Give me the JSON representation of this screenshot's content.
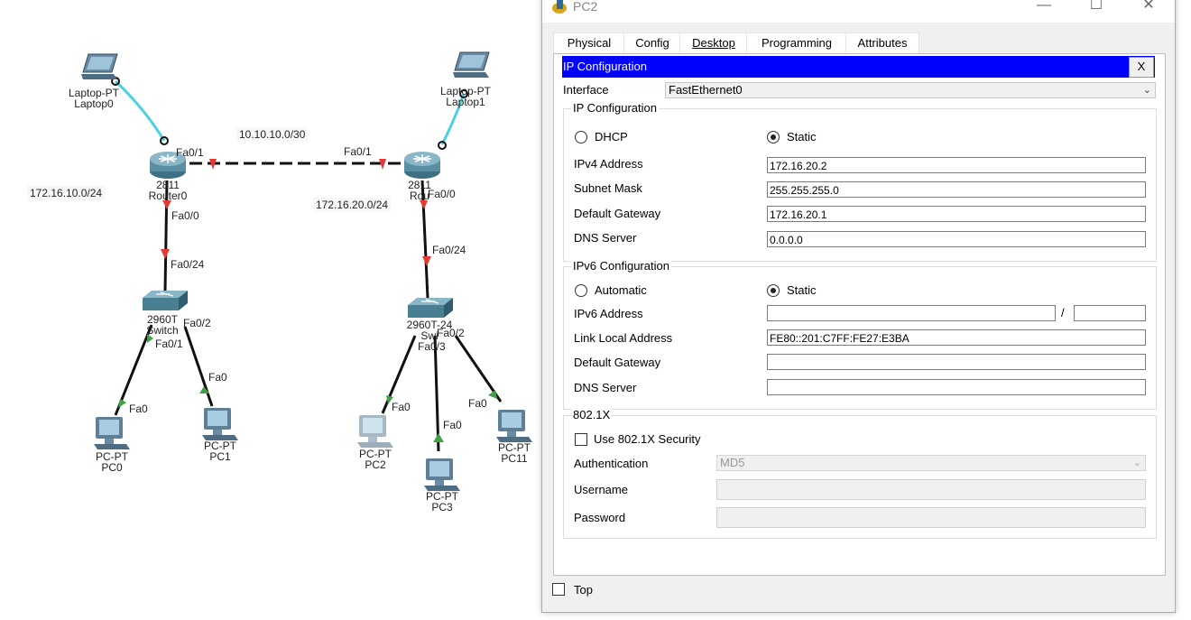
{
  "topology": {
    "devices": {
      "laptop0": {
        "line1": "Laptop-PT",
        "line2": "Laptop0"
      },
      "laptop1": {
        "line1": "Laptop-PT",
        "line2": "Laptop1"
      },
      "router0": {
        "line1": "2811",
        "line2": "Router0"
      },
      "router1": {
        "line1": "2811",
        "line2": "Rou"
      },
      "switch0": {
        "line1": "2960T",
        "line2": "Switch"
      },
      "switch1": {
        "line1": "2960T-24",
        "line2": "Swi"
      },
      "pc0": {
        "line1": "PC-PT",
        "line2": "PC0"
      },
      "pc1": {
        "line1": "PC-PT",
        "line2": "PC1"
      },
      "pc2": {
        "line1": "PC-PT",
        "line2": "PC2"
      },
      "pc3": {
        "line1": "PC-PT",
        "line2": "PC3"
      },
      "pc11": {
        "line1": "PC-PT",
        "line2": "PC11"
      }
    },
    "networks": {
      "wan": "10.10.10.0/30",
      "lan0": "172.16.10.0/24",
      "lan1": "172.16.20.0/24"
    },
    "ports": {
      "r0_fa01": "Fa0/1",
      "r0_fa00": "Fa0/0",
      "sw0_fa024": "Fa0/24",
      "sw0_fa02": "Fa0/2",
      "sw0_fa01": "Fa0/1",
      "pc0_fa0": "Fa0",
      "pc1_fa0": "Fa0",
      "r1_fa01": "Fa0/1",
      "r1_fa00": "Fa0/0",
      "sw1_fa024": "Fa0/24",
      "sw1_fa02": "Fa0/2",
      "sw1_fa03": "Fa0/3",
      "pc2_fa0": "Fa0",
      "pc3_fa0": "Fa0",
      "pc11_fa0": "Fa0"
    }
  },
  "window": {
    "title": "PC2",
    "buttons": {
      "minimize": "—",
      "maximize": "☐",
      "close": "✕"
    },
    "tabs": [
      {
        "label": "Physical"
      },
      {
        "label": "Config"
      },
      {
        "label": "Desktop"
      },
      {
        "label": "Programming"
      },
      {
        "label": "Attributes"
      }
    ],
    "active_tab": "Desktop",
    "ip_config": {
      "title": "IP Configuration",
      "close": "X",
      "interface_label": "Interface",
      "interface_value": "FastEthernet0",
      "ipv4_group": "IP Configuration",
      "dhcp_label": "DHCP",
      "static_label": "Static",
      "ipv4_address_label": "IPv4 Address",
      "ipv4_address": "172.16.20.2",
      "subnet_mask_label": "Subnet Mask",
      "subnet_mask": "255.255.255.0",
      "gateway_label": "Default Gateway",
      "gateway": "172.16.20.1",
      "dns_label": "DNS Server",
      "dns": "0.0.0.0",
      "ipv6_group": "IPv6 Configuration",
      "auto_label": "Automatic",
      "static6_label": "Static",
      "ipv6_address_label": "IPv6 Address",
      "ipv6_address": "",
      "ipv6_slash": "/",
      "ipv6_prefix": "",
      "link_local_label": "Link Local Address",
      "link_local": "FE80::201:C7FF:FE27:E3BA",
      "gateway6_label": "Default Gateway",
      "gateway6": "",
      "dns6_label": "DNS Server",
      "dns6": "",
      "dot1x_group": "802.1X",
      "dot1x_label": "Use 802.1X Security",
      "auth_label": "Authentication",
      "auth_value": "MD5",
      "username_label": "Username",
      "username": "",
      "password_label": "Password",
      "password": ""
    },
    "top_label": "Top"
  },
  "colors": {
    "title_bar_blue": "#0000ff",
    "active_tab_underline": "#003e8e",
    "console_link": "#4dd0e1",
    "link_down": "#e53935",
    "link_up": "#43a047"
  }
}
